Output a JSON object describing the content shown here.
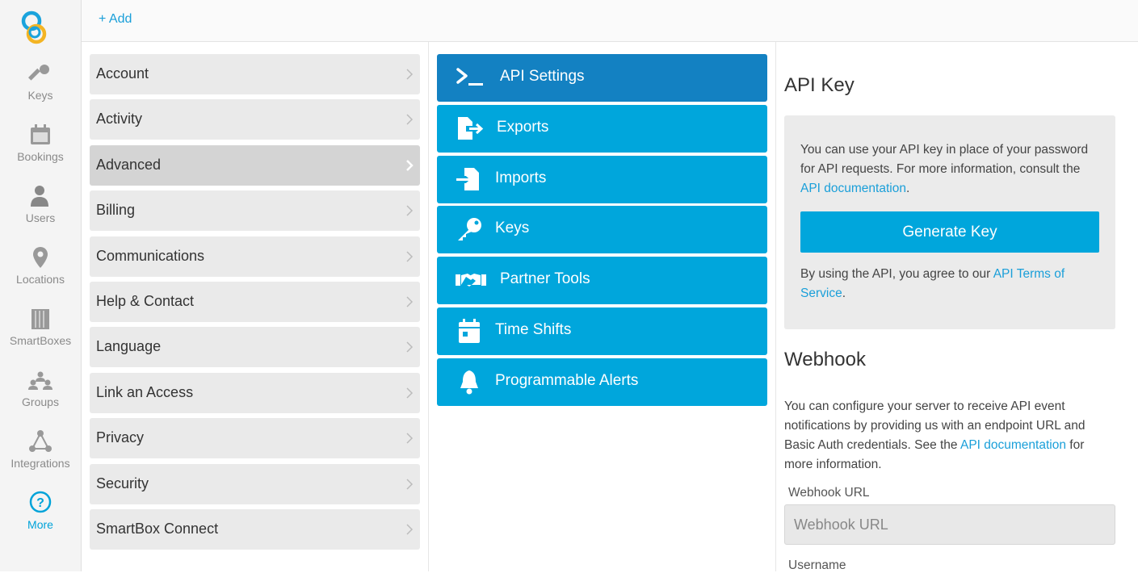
{
  "rail": {
    "items": [
      {
        "label": "Keys",
        "icon": "key-icon"
      },
      {
        "label": "Bookings",
        "icon": "calendar-icon"
      },
      {
        "label": "Users",
        "icon": "user-icon"
      },
      {
        "label": "Locations",
        "icon": "location-pin-icon"
      },
      {
        "label": "SmartBoxes",
        "icon": "smartbox-icon"
      },
      {
        "label": "Groups",
        "icon": "groups-icon"
      },
      {
        "label": "Integrations",
        "icon": "integrations-icon"
      },
      {
        "label": "More",
        "icon": "help-icon"
      }
    ]
  },
  "topbar": {
    "add_label": "+ Add"
  },
  "settings_menu": {
    "items": [
      "Account",
      "Activity",
      "Advanced",
      "Billing",
      "Communications",
      "Help & Contact",
      "Language",
      "Link an Access",
      "Privacy",
      "Security",
      "SmartBox Connect"
    ],
    "selected": "Advanced"
  },
  "advanced_menu": {
    "items": [
      {
        "label": "API Settings",
        "icon": "terminal-icon"
      },
      {
        "label": "Exports",
        "icon": "export-icon"
      },
      {
        "label": "Imports",
        "icon": "import-icon"
      },
      {
        "label": "Keys",
        "icon": "key-icon"
      },
      {
        "label": "Partner Tools",
        "icon": "handshake-icon"
      },
      {
        "label": "Time Shifts",
        "icon": "calendar-icon"
      },
      {
        "label": "Programmable Alerts",
        "icon": "bell-icon"
      }
    ],
    "active": "API Settings"
  },
  "api_key": {
    "heading": "API Key",
    "desc_pre": "You can use your API key in place of your password for API requests. For more information, consult the ",
    "desc_link": "API documentation",
    "desc_post": ".",
    "button_label": "Generate Key",
    "terms_pre": "By using the API, you agree to our ",
    "terms_link": "API Terms of Service",
    "terms_post": "."
  },
  "webhook": {
    "heading": "Webhook",
    "desc_pre": "You can configure your server to receive API event notifications by providing us with an endpoint URL and Basic Auth credentials. See the ",
    "desc_link": "API documentation",
    "desc_post": " for more information.",
    "url_label": "Webhook URL",
    "url_placeholder": "Webhook URL",
    "username_label": "Username"
  },
  "colors": {
    "accent": "#00a6dc",
    "active_tile": "#1381c2",
    "link": "#1a9fd9"
  }
}
